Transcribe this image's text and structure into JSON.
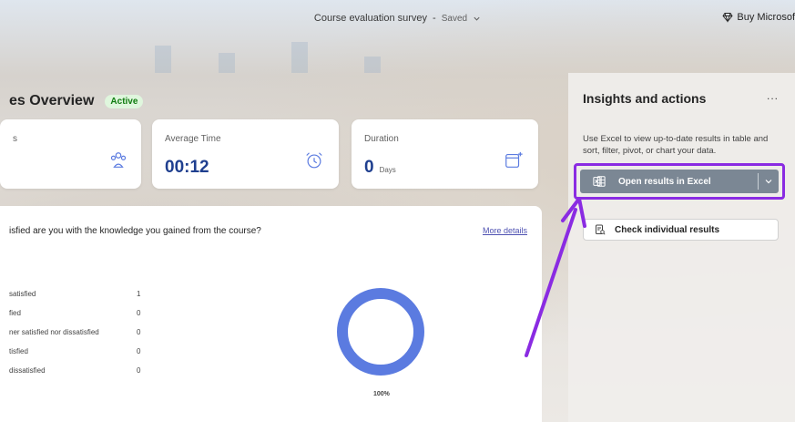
{
  "topbar": {
    "survey_title": "Course evaluation survey",
    "separator": "-",
    "status": "Saved",
    "buy_label": "Buy Microsof"
  },
  "overview": {
    "title": "es Overview",
    "badge": "Active"
  },
  "cards": [
    {
      "label": "s",
      "value": "",
      "icon": "people-icon"
    },
    {
      "label": "Average Time",
      "value": "00:12",
      "icon": "alarm-clock-icon"
    },
    {
      "label": "Duration",
      "value": "0",
      "unit": "Days",
      "icon": "calendar-add-icon"
    }
  ],
  "question": {
    "text": "isfied are you with the knowledge you gained from the course?",
    "more_details": "More details",
    "rows": [
      {
        "label": "satisfied",
        "count": "1"
      },
      {
        "label": "fied",
        "count": "0"
      },
      {
        "label": "ner satisfied nor dissatisfied",
        "count": "0"
      },
      {
        "label": "tisfied",
        "count": "0"
      },
      {
        "label": "dissatisfied",
        "count": "0"
      }
    ],
    "percent_label": "100%"
  },
  "chart_data": {
    "type": "pie",
    "categories": [
      "satisfied",
      "fied",
      "ner satisfied nor dissatisfied",
      "tisfied",
      "dissatisfied"
    ],
    "values": [
      1,
      0,
      0,
      0,
      0
    ],
    "title": ""
  },
  "insights": {
    "title": "Insights and actions",
    "more": "...",
    "description": "Use Excel to view up-to-date results in table and sort, filter, pivot, or chart your data.",
    "excel_button": "Open results in Excel",
    "check_button": "Check individual results"
  },
  "colors": {
    "accent": "#5b7be0",
    "highlight": "#8a2be2",
    "active_green": "#107c10",
    "excel_button_bg": "#7b8794"
  }
}
